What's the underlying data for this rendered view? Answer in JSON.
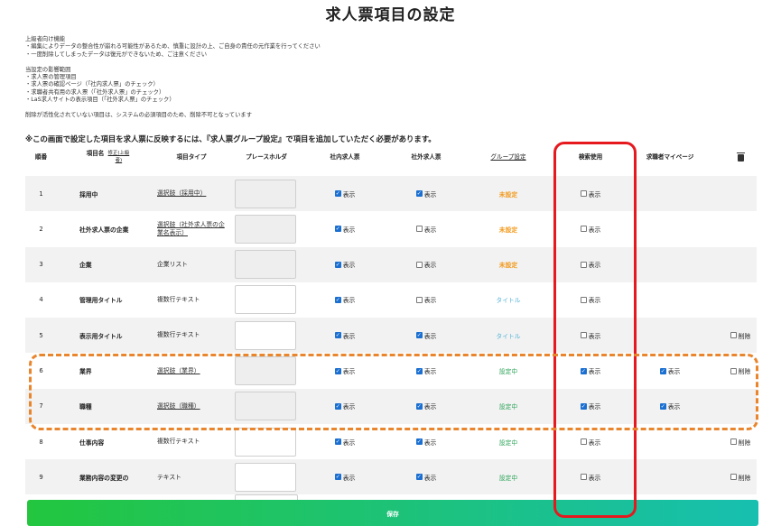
{
  "page": {
    "title": "求人票項目の設定",
    "notes": [
      [
        "上級者向け機能",
        "・編集によりデータの整合性が崩れる可能性があるため、慎重に設計の上、ご自身の責任の元作業を行ってください",
        "・一度削除してしまったデータは復元ができないため、ご注意ください"
      ],
      [
        "当設定の影響範囲",
        "・求人票の管理項目",
        "・求人票の確認ページ（「社内求人票」のチェック）",
        "・求職者共有用の求人票（「社外求人票」のチェック）",
        "・LaS求人サイトの表示項目（「社外求人票」のチェック）"
      ],
      [
        "削除が活性化されていない項目は、システムの必須項目のため、削除不可となっています"
      ]
    ],
    "notice": "※この画面で設定した項目を求人票に反映するには、『求人票グループ設定』で項目を追加していただく必要があります。",
    "save_label": "保存"
  },
  "columns": {
    "order": "順番",
    "item_name": "項目名",
    "item_name_sub": "修正(上級者)",
    "item_type": "項目タイプ",
    "placeholder": "プレースホルダ",
    "internal": "社内求人票",
    "external": "社外求人票",
    "group": "グループ設定",
    "search": "検索使用",
    "mypage": "求職者マイページ"
  },
  "labels": {
    "show": "表示",
    "delete": "削除"
  },
  "rows": [
    {
      "num": "1",
      "name": "採用中",
      "type": "選択肢（採用中）",
      "type_link": true,
      "ph_disabled": true,
      "internal": true,
      "external": true,
      "group": "未設定",
      "group_style": "unset",
      "search": false,
      "mypage": null,
      "delete": null
    },
    {
      "num": "2",
      "name": "社外求人票の企業",
      "type": "選択肢（社外求人票の企業名表示）",
      "type_link": true,
      "ph_disabled": true,
      "internal": true,
      "external": false,
      "group": "未設定",
      "group_style": "unset",
      "search": false,
      "mypage": null,
      "delete": null
    },
    {
      "num": "3",
      "name": "企業",
      "type": "企業リスト",
      "type_link": false,
      "ph_disabled": true,
      "internal": true,
      "external": false,
      "group": "未設定",
      "group_style": "unset",
      "search": false,
      "mypage": null,
      "delete": null
    },
    {
      "num": "4",
      "name": "管理用タイトル",
      "type": "複数行テキスト",
      "type_link": false,
      "ph_disabled": false,
      "internal": true,
      "external": false,
      "group": "タイトル",
      "group_style": "title",
      "search": false,
      "mypage": null,
      "delete": null
    },
    {
      "num": "5",
      "name": "表示用タイトル",
      "type": "複数行テキスト",
      "type_link": false,
      "ph_disabled": false,
      "internal": true,
      "external": true,
      "group": "タイトル",
      "group_style": "title",
      "search": false,
      "mypage": null,
      "delete": false
    },
    {
      "num": "6",
      "name": "業界",
      "type": "選択肢（業界）",
      "type_link": true,
      "ph_disabled": true,
      "internal": true,
      "external": true,
      "group": "設定中",
      "group_style": "set",
      "search": true,
      "mypage": true,
      "delete": false
    },
    {
      "num": "7",
      "name": "職種",
      "type": "選択肢（職種）",
      "type_link": true,
      "ph_disabled": true,
      "internal": true,
      "external": true,
      "group": "設定中",
      "group_style": "set",
      "search": true,
      "mypage": true,
      "delete": null
    },
    {
      "num": "8",
      "name": "仕事内容",
      "type": "複数行テキスト",
      "type_link": false,
      "ph_disabled": false,
      "internal": true,
      "external": true,
      "group": "設定中",
      "group_style": "set",
      "search": false,
      "mypage": null,
      "delete": false
    },
    {
      "num": "9",
      "name": "業務内容の変更の",
      "type": "テキスト",
      "type_link": false,
      "ph_disabled": false,
      "internal": true,
      "external": true,
      "group": "設定中",
      "group_style": "set",
      "search": false,
      "mypage": null,
      "delete": false
    }
  ],
  "colors": {
    "accent_blue": "#1a6fd1",
    "unset_orange": "#f29a1c",
    "set_green": "#2aa356",
    "title_blue": "#54b3d6",
    "highlight_red": "#e5191e",
    "highlight_orange": "#e9852d"
  }
}
